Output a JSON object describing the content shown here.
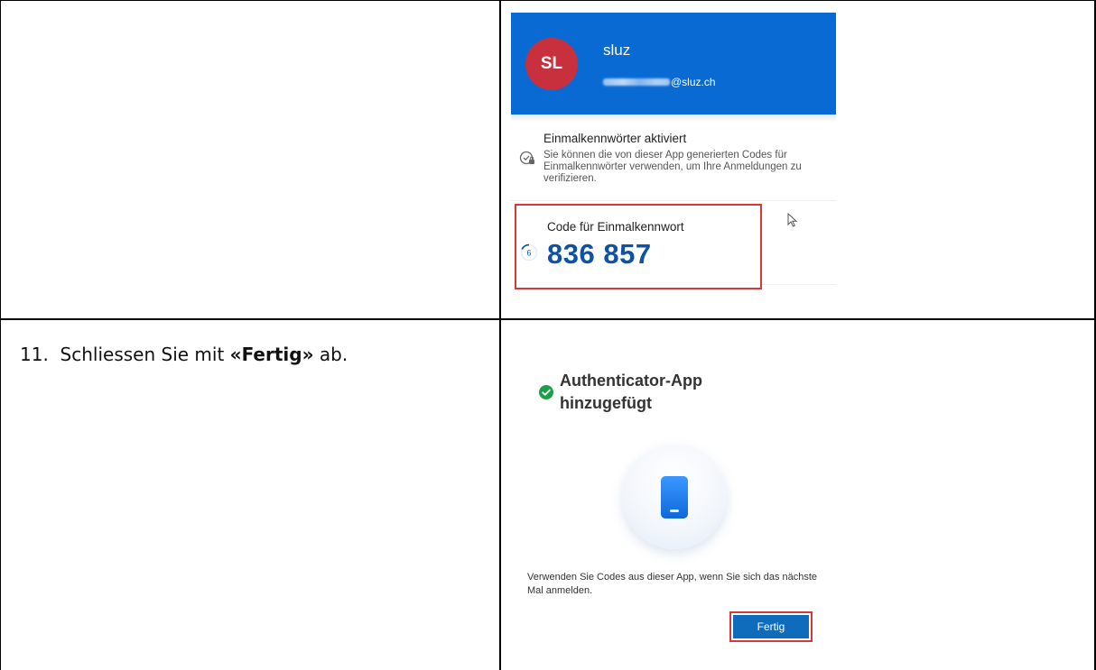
{
  "row1": {
    "account": {
      "initials": "SL",
      "name": "sluz",
      "email_suffix": "@sluz.ch"
    },
    "otp_section": {
      "title": "Einmalkennwörter aktiviert",
      "description": "Sie können die von dieser App generierten Codes für Einmalkennwörter verwenden, um Ihre Anmeldungen zu verifizieren."
    },
    "code_card": {
      "label": "Code für Einmalkennwort",
      "timer_seconds": "6",
      "code": "836 857"
    },
    "colors": {
      "header_blue": "#0a6ad4",
      "avatar_red": "#c8303d",
      "code_blue": "#0e52a6",
      "highlight_red": "#d33a3a"
    }
  },
  "row2": {
    "instruction": {
      "number": "11.",
      "prefix": "Schliessen Sie mit",
      "bold": "«Fertig»",
      "suffix": "ab."
    },
    "result": {
      "title": "Authenticator-App hinzugefügt",
      "message": "Verwenden Sie Codes aus dieser App, wenn Sie sich das nächste Mal anmelden.",
      "button_label": "Fertig"
    },
    "icons": [
      "check-circle-icon",
      "smartphone-icon"
    ],
    "colors": {
      "success_green": "#1e9e4a",
      "button_blue": "#0f6cbd"
    }
  }
}
